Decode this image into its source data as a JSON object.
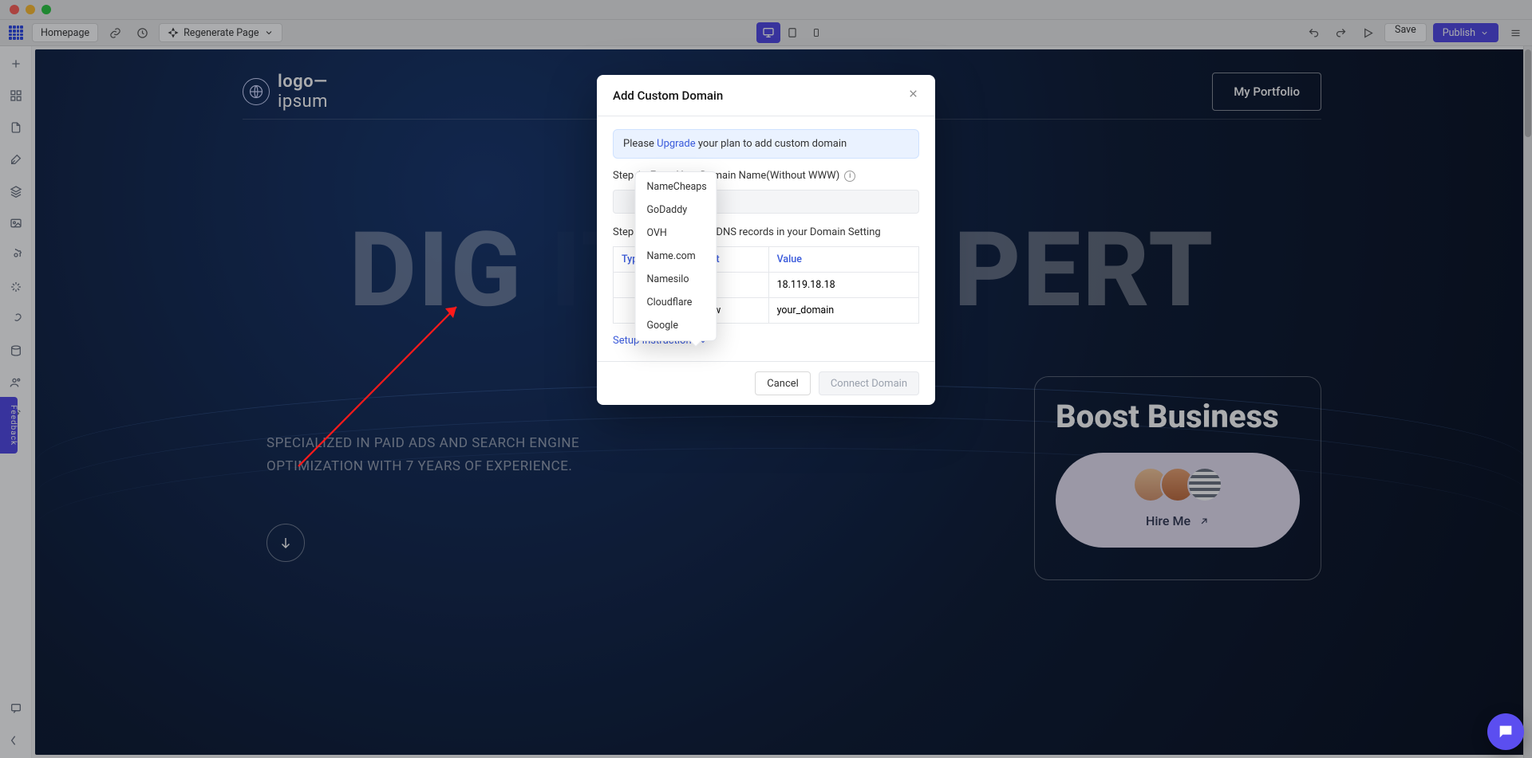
{
  "topbar": {
    "page_chip": "Homepage",
    "regenerate": "Regenerate Page",
    "save": "Save",
    "publish": "Publish"
  },
  "rail": {
    "feedback": "Feedback"
  },
  "site": {
    "brand": "logo—",
    "brand2": "ipsum",
    "portfolio": "My Portfolio",
    "hero_title_left": "DIG",
    "hero_title_right": "PERT",
    "subhead": "SPECIALIZED IN PAID ADS AND SEARCH ENGINE OPTIMIZATION WITH 7 YEARS OF EXPERIENCE.",
    "boost_title": "Boost Business",
    "hire": "Hire Me"
  },
  "modal": {
    "title": "Add Custom Domain",
    "banner_pre": "Please ",
    "banner_link": "Upgrade",
    "banner_post": " your plan to add custom domain",
    "step1": "Step 1 - Enter Your Domain Name(Without WWW)",
    "step2": "Step 2 - Add following DNS records in your Domain Setting",
    "th_type": "Type",
    "th_host": "Host",
    "th_value": "Value",
    "rows": [
      {
        "type": "",
        "host": "@",
        "value": "18.119.18.18"
      },
      {
        "type": "",
        "host": "www",
        "value": "your_domain"
      }
    ],
    "setup": "Setup Instructions",
    "cancel": "Cancel",
    "connect": "Connect Domain"
  },
  "registrars": [
    "NameCheaps",
    "GoDaddy",
    "OVH",
    "Name.com",
    "Namesilo",
    "Cloudflare",
    "Google"
  ]
}
